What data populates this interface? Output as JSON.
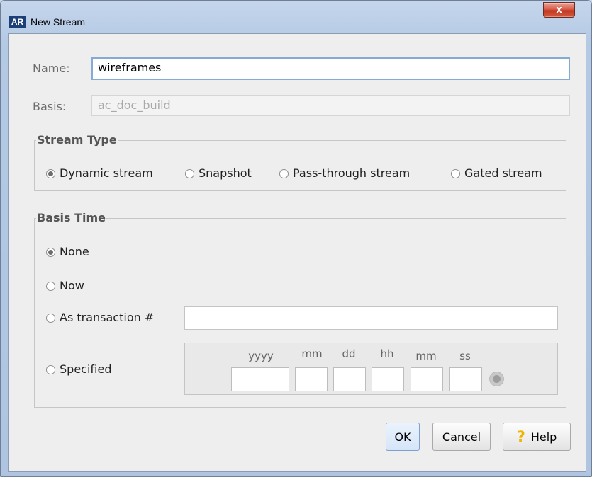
{
  "window": {
    "title": "New Stream",
    "logo_text": "AR",
    "close_glyph": "x"
  },
  "form": {
    "name_label": "Name:",
    "name_value": "wireframes",
    "basis_label": "Basis:",
    "basis_value": "ac_doc_build"
  },
  "stream_type": {
    "legend": "Stream Type",
    "options": [
      {
        "label": "Dynamic stream",
        "selected": true
      },
      {
        "label": "Snapshot",
        "selected": false
      },
      {
        "label": "Pass-through stream",
        "selected": false
      },
      {
        "label": "Gated stream",
        "selected": false
      }
    ]
  },
  "basis_time": {
    "legend": "Basis Time",
    "options": [
      {
        "label": "None",
        "selected": true
      },
      {
        "label": "Now",
        "selected": false
      },
      {
        "label": "As transaction #",
        "selected": false
      },
      {
        "label": "Specified",
        "selected": false
      }
    ],
    "transaction_value": "",
    "date_labels": [
      "yyyy",
      "mm",
      "dd",
      "hh",
      "mm",
      "ss"
    ],
    "date_values": [
      "",
      "",
      "",
      "",
      "",
      ""
    ]
  },
  "buttons": {
    "ok_mnemonic": "O",
    "ok_rest": "K",
    "cancel_mnemonic": "C",
    "cancel_rest": "ancel",
    "help_glyph": "?",
    "help_mnemonic": "H",
    "help_rest": "elp"
  },
  "colors": {
    "focus_border": "#86a9d6",
    "help_icon": "#f0b400",
    "close_button": "#c2371f"
  }
}
